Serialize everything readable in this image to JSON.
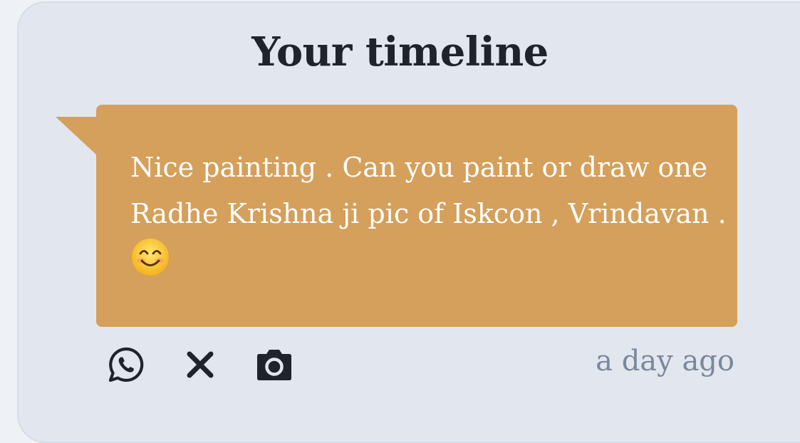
{
  "timeline": {
    "title": "Your timeline"
  },
  "message": {
    "text": "Nice painting . Can you paint or draw one Radhe Krishna ji pic of Iskcon , Vrindavan .",
    "emoji": "smiling-face-emoji",
    "bubble_color": "#d4a05b",
    "text_color": "#ffffff"
  },
  "actions": [
    {
      "icon": "whatsapp-icon"
    },
    {
      "icon": "close-icon"
    },
    {
      "icon": "camera-icon"
    }
  ],
  "timestamp": "a day ago",
  "colors": {
    "background": "#e2e7ef",
    "title": "#1f232b",
    "timestamp": "#7b879b",
    "icon": "#1f232b"
  }
}
